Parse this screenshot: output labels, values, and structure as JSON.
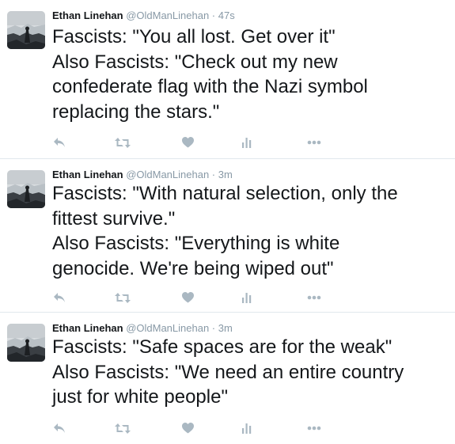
{
  "tweets": [
    {
      "author_name": "Ethan Linehan",
      "handle": "@OldManLinehan",
      "separator": "·",
      "time": "47s",
      "lines": [
        "Fascists: \"You all lost. Get over it\"",
        "Also Fascists: \"Check out my new",
        "confederate flag with the Nazi symbol",
        "replacing the stars.\""
      ]
    },
    {
      "author_name": "Ethan Linehan",
      "handle": "@OldManLinehan",
      "separator": "·",
      "time": "3m",
      "lines": [
        "Fascists: \"With natural selection, only the",
        "fittest survive.\"",
        "Also Fascists: \"Everything is white",
        "genocide. We're being wiped out\""
      ]
    },
    {
      "author_name": "Ethan Linehan",
      "handle": "@OldManLinehan",
      "separator": "·",
      "time": "3m",
      "lines": [
        "Fascists: \"Safe spaces are for the weak\"",
        "Also Fascists: \"We need an entire country",
        "just for white people\""
      ]
    }
  ],
  "action_icons": [
    "reply-icon",
    "retweet-icon",
    "like-icon",
    "analytics-icon",
    "more-icon"
  ],
  "colors": {
    "text": "#14171a",
    "secondary": "#8899a6",
    "icon": "#aab8c2",
    "divider": "#e1e8ed"
  }
}
